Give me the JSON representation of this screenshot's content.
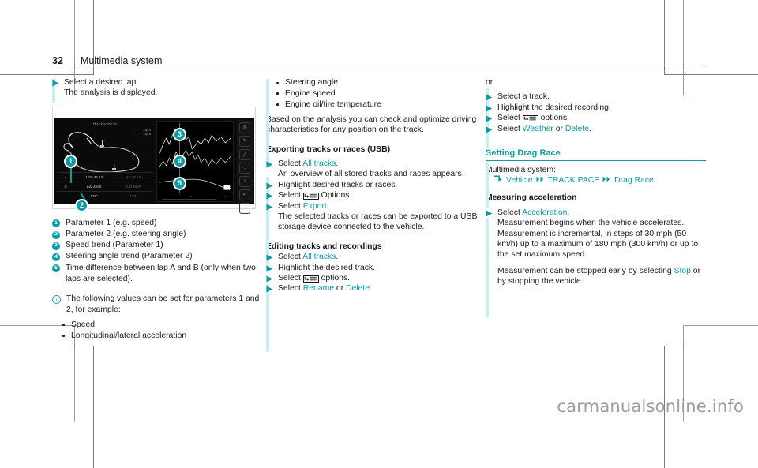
{
  "header": {
    "page_number": "32",
    "title": "Multimedia system"
  },
  "colors": {
    "accent": "#0d9aa3",
    "changebar": "#c7f0f2",
    "text": "#1a1a1a"
  },
  "col1": {
    "step_select_lap": "Select a desired lap.",
    "step_select_lap_sub": "The analysis is displayed.",
    "figure": {
      "track_name": "Hockenheim",
      "legend": [
        "Lap A",
        "Lap B"
      ],
      "table": [
        {
          "label": "A",
          "v1": "1:01:45.13",
          "v2": "+1:45.13"
        },
        {
          "label": "B",
          "v1": "142 km/h",
          "v2": "132 km/h"
        },
        {
          "label": "",
          "v1": "128°",
          "v2": "120°"
        }
      ],
      "callouts": [
        "1",
        "2",
        "3",
        "4",
        "5"
      ]
    },
    "legend_items": [
      {
        "num": "1",
        "text": "Parameter 1 (e.g. speed)"
      },
      {
        "num": "2",
        "text": "Parameter 2 (e.g. steering angle)"
      },
      {
        "num": "3",
        "text": "Speed trend (Parameter 1)"
      },
      {
        "num": "4",
        "text": "Steering angle trend (Parameter 2)"
      },
      {
        "num": "5",
        "text": "Time difference between lap A and B (only when two laps are selected)."
      }
    ],
    "note_text": "The following values can be set for parameters 1 and 2, for example:",
    "note_bullets": [
      "Speed",
      "Longitudinal/lateral acceleration"
    ]
  },
  "col2": {
    "bullets_top": [
      "Steering angle",
      "Engine speed",
      "Engine oil/tire temperature"
    ],
    "para_based": "Based on the analysis you can check and optimize driving characteristics for any position on the track.",
    "heading_export": "Exporting tracks or races (USB)",
    "export_steps": [
      {
        "pre": "Select ",
        "link": "All tracks",
        "post": ".",
        "sub": "An overview of all stored tracks and races appears."
      },
      {
        "pre": "Highlight desired tracks or races.",
        "link": "",
        "post": "",
        "sub": ""
      },
      {
        "pre": "Select ",
        "icon": "options-icon",
        "post": " Options.",
        "sub": ""
      },
      {
        "pre": "Select ",
        "link": "Export",
        "post": ".",
        "sub": "The selected tracks or races can be exported to a USB storage device connected to the vehicle."
      }
    ],
    "heading_editing": "Editing tracks and recordings",
    "editing_steps": [
      {
        "pre": "Select ",
        "link": "All tracks",
        "post": "."
      },
      {
        "pre": "Highlight the desired track.",
        "link": "",
        "post": ""
      },
      {
        "pre": "Select ",
        "icon": "options-icon",
        "post": " options."
      },
      {
        "pre": "Select ",
        "link": "Rename",
        "mid": " or ",
        "link2": "Delete",
        "post": "."
      }
    ]
  },
  "col3": {
    "or_label": "or",
    "or_steps": [
      {
        "pre": "Select a track.",
        "link": "",
        "post": ""
      },
      {
        "pre": "Highlight the desired recording.",
        "link": "",
        "post": ""
      },
      {
        "pre": "Select ",
        "icon": "options-icon",
        "post": " options."
      },
      {
        "pre": "Select ",
        "link": "Weather",
        "mid": " or ",
        "link2": "Delete",
        "post": "."
      }
    ],
    "heading_drag": "Setting Drag Race",
    "menu_label": "Multimedia system:",
    "menu_path": [
      "Vehicle",
      "TRACK PACE",
      "Drag Race"
    ],
    "heading_measure": "Measuring acceleration",
    "measure_step": {
      "pre": "Select ",
      "link": "Acceleration",
      "post": "."
    },
    "measure_body": "Measurement begins when the vehicle accelerates. Measurement is incremental, in steps of 30 mph (50 km/h) up to a maximum of 180 mph (300 km/h) or up to the set maximum speed.",
    "measure_body2_pre": "Measurement can be stopped early by selecting ",
    "measure_body2_link": "Stop",
    "measure_body2_post": " or by stopping the vehicle."
  },
  "watermark": "carmanualsonline.info"
}
